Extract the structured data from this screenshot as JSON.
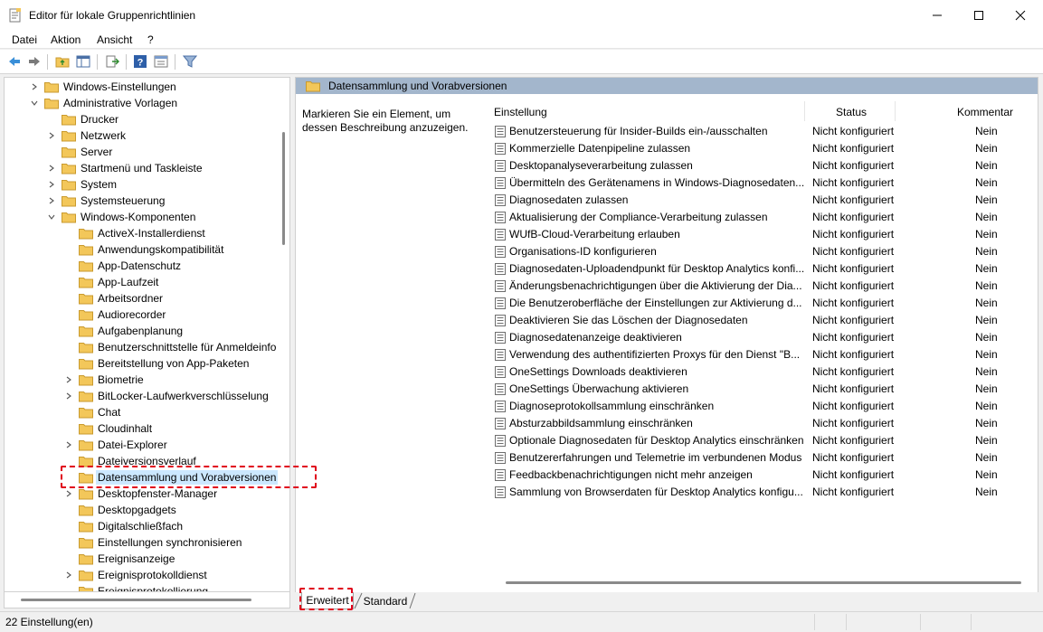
{
  "window": {
    "title": "Editor für lokale Gruppenrichtlinien"
  },
  "menu": [
    "Datei",
    "Aktion",
    "Ansicht",
    "?"
  ],
  "toolbar_icons": [
    "back-arrow-icon",
    "forward-arrow-icon",
    "up-folder-icon",
    "show-hide-tree-icon",
    "export-list-icon",
    "help-icon",
    "properties-icon",
    "filter-icon"
  ],
  "tree": [
    {
      "label": "Windows-Einstellungen",
      "level": 1,
      "expander": "collapsed"
    },
    {
      "label": "Administrative Vorlagen",
      "level": 1,
      "expander": "expanded"
    },
    {
      "label": "Drucker",
      "level": 2,
      "expander": "none"
    },
    {
      "label": "Netzwerk",
      "level": 2,
      "expander": "collapsed"
    },
    {
      "label": "Server",
      "level": 2,
      "expander": "none"
    },
    {
      "label": "Startmenü und Taskleiste",
      "level": 2,
      "expander": "collapsed"
    },
    {
      "label": "System",
      "level": 2,
      "expander": "collapsed"
    },
    {
      "label": "Systemsteuerung",
      "level": 2,
      "expander": "collapsed"
    },
    {
      "label": "Windows-Komponenten",
      "level": 2,
      "expander": "expanded"
    },
    {
      "label": "ActiveX-Installerdienst",
      "level": 3,
      "expander": "none"
    },
    {
      "label": "Anwendungskompatibilität",
      "level": 3,
      "expander": "none"
    },
    {
      "label": "App-Datenschutz",
      "level": 3,
      "expander": "none"
    },
    {
      "label": "App-Laufzeit",
      "level": 3,
      "expander": "none"
    },
    {
      "label": "Arbeitsordner",
      "level": 3,
      "expander": "none"
    },
    {
      "label": "Audiorecorder",
      "level": 3,
      "expander": "none"
    },
    {
      "label": "Aufgabenplanung",
      "level": 3,
      "expander": "none"
    },
    {
      "label": "Benutzerschnittstelle für Anmeldeinfo",
      "level": 3,
      "expander": "none"
    },
    {
      "label": "Bereitstellung von App-Paketen",
      "level": 3,
      "expander": "none"
    },
    {
      "label": "Biometrie",
      "level": 3,
      "expander": "collapsed"
    },
    {
      "label": "BitLocker-Laufwerkverschlüsselung",
      "level": 3,
      "expander": "collapsed"
    },
    {
      "label": "Chat",
      "level": 3,
      "expander": "none"
    },
    {
      "label": "Cloudinhalt",
      "level": 3,
      "expander": "none"
    },
    {
      "label": "Datei-Explorer",
      "level": 3,
      "expander": "collapsed"
    },
    {
      "label": "Dateiversionsverlauf",
      "level": 3,
      "expander": "none"
    },
    {
      "label": "Datensammlung und Vorabversionen",
      "level": 3,
      "expander": "none",
      "selected": true
    },
    {
      "label": "Desktopfenster-Manager",
      "level": 3,
      "expander": "collapsed"
    },
    {
      "label": "Desktopgadgets",
      "level": 3,
      "expander": "none"
    },
    {
      "label": "Digitalschließfach",
      "level": 3,
      "expander": "none"
    },
    {
      "label": "Einstellungen synchronisieren",
      "level": 3,
      "expander": "none"
    },
    {
      "label": "Ereignisanzeige",
      "level": 3,
      "expander": "none"
    },
    {
      "label": "Ereignisprotokolldienst",
      "level": 3,
      "expander": "collapsed"
    },
    {
      "label": "Ereignisprotokollierung",
      "level": 3,
      "expander": "none"
    }
  ],
  "panel": {
    "header": "Datensammlung und Vorabversionen",
    "description": "Markieren Sie ein Element, um dessen Beschreibung anzuzeigen.",
    "columns": {
      "setting": "Einstellung",
      "status": "Status",
      "comment": "Kommentar"
    },
    "rows": [
      {
        "name": "Benutzersteuerung für Insider-Builds ein-/ausschalten",
        "status": "Nicht konfiguriert",
        "comment": "Nein"
      },
      {
        "name": "Kommerzielle Datenpipeline zulassen",
        "status": "Nicht konfiguriert",
        "comment": "Nein"
      },
      {
        "name": "Desktopanalyseverarbeitung zulassen",
        "status": "Nicht konfiguriert",
        "comment": "Nein"
      },
      {
        "name": "Übermitteln des Gerätenamens in Windows-Diagnosedaten zulassen",
        "status": "Nicht konfiguriert",
        "comment": "Nein"
      },
      {
        "name": "Diagnosedaten zulassen",
        "status": "Nicht konfiguriert",
        "comment": "Nein"
      },
      {
        "name": "Aktualisierung der Compliance-Verarbeitung zulassen",
        "status": "Nicht konfiguriert",
        "comment": "Nein"
      },
      {
        "name": "WUfB-Cloud-Verarbeitung erlauben",
        "status": "Nicht konfiguriert",
        "comment": "Nein"
      },
      {
        "name": "Organisations-ID konfigurieren",
        "status": "Nicht konfiguriert",
        "comment": "Nein"
      },
      {
        "name": "Diagnosedaten-Uploadendpunkt für Desktop Analytics konfigurieren",
        "status": "Nicht konfiguriert",
        "comment": "Nein"
      },
      {
        "name": "Änderungsbenachrichtigungen über die Aktivierung der Diagnosedaten",
        "status": "Nicht konfiguriert",
        "comment": "Nein"
      },
      {
        "name": "Die Benutzeroberfläche der Einstellungen zur Aktivierung der Diagnosedaten",
        "status": "Nicht konfiguriert",
        "comment": "Nein"
      },
      {
        "name": "Deaktivieren Sie das Löschen der Diagnosedaten",
        "status": "Nicht konfiguriert",
        "comment": "Nein"
      },
      {
        "name": "Diagnosedatenanzeige deaktivieren",
        "status": "Nicht konfiguriert",
        "comment": "Nein"
      },
      {
        "name": "Verwendung des authentifizierten Proxys für den Dienst \"Benutzererfahrungen\"",
        "status": "Nicht konfiguriert",
        "comment": "Nein"
      },
      {
        "name": "OneSettings Downloads deaktivieren",
        "status": "Nicht konfiguriert",
        "comment": "Nein"
      },
      {
        "name": "OneSettings Überwachung aktivieren",
        "status": "Nicht konfiguriert",
        "comment": "Nein"
      },
      {
        "name": "Diagnoseprotokollsammlung einschränken",
        "status": "Nicht konfiguriert",
        "comment": "Nein"
      },
      {
        "name": "Absturzabbildsammlung einschränken",
        "status": "Nicht konfiguriert",
        "comment": "Nein"
      },
      {
        "name": "Optionale Diagnosedaten für Desktop Analytics einschränken",
        "status": "Nicht konfiguriert",
        "comment": "Nein"
      },
      {
        "name": "Benutzererfahrungen und Telemetrie im verbundenen Modus",
        "status": "Nicht konfiguriert",
        "comment": "Nein"
      },
      {
        "name": "Feedbackbenachrichtigungen nicht mehr anzeigen",
        "status": "Nicht konfiguriert",
        "comment": "Nein"
      },
      {
        "name": "Sammlung von Browserdaten für Desktop Analytics konfigurieren",
        "status": "Nicht konfiguriert",
        "comment": "Nein"
      }
    ]
  },
  "tabs": {
    "extended": "Erweitert",
    "standard": "Standard"
  },
  "statusbar": {
    "text": "22 Einstellung(en)"
  },
  "colors": {
    "header_bg": "#a3b6cc",
    "selection": "#cce8ff",
    "highlight": "#e0001a",
    "folder": "#f3c75a"
  }
}
